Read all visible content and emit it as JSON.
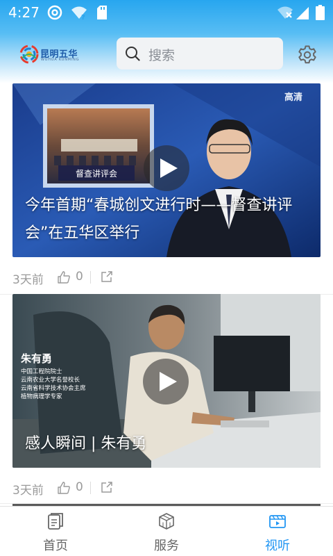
{
  "status_bar": {
    "time": "4:27",
    "icons": [
      "at-sign-icon",
      "wifi-question-icon",
      "sd-card-icon",
      "wifi-off-icon",
      "signal-icon",
      "battery-icon"
    ]
  },
  "header": {
    "logo_text": "昆明五华",
    "logo_subtext": "WUHUA KUNMING",
    "search_placeholder": "搜索",
    "settings_icon": "gear-icon"
  },
  "feed": [
    {
      "title": "今年首期“春城创文进行时——督查讲评会”在五华区举行",
      "time": "3天前",
      "likes": "0",
      "thumb_overlay_text": "督查讲评会",
      "thumb_corner_text": "高清"
    },
    {
      "title": "感人瞬间 | 朱有勇",
      "time": "3天前",
      "likes": "0",
      "thumb_name": "朱有勇",
      "thumb_caption_lines": [
        "中国工程院院士",
        "云南农业大学名誉校长",
        "云南省科学技术协会主席",
        "植物病理学专家"
      ]
    }
  ],
  "bottom_nav": [
    {
      "label": "首页",
      "icon": "home-doc-icon",
      "active": false
    },
    {
      "label": "服务",
      "icon": "service-cube-icon",
      "active": false
    },
    {
      "label": "视听",
      "icon": "video-icon",
      "active": true
    }
  ],
  "colors": {
    "accent": "#2196f3",
    "header_gradient_top": "#27a6ef",
    "meta_text": "#9a9a9a"
  }
}
